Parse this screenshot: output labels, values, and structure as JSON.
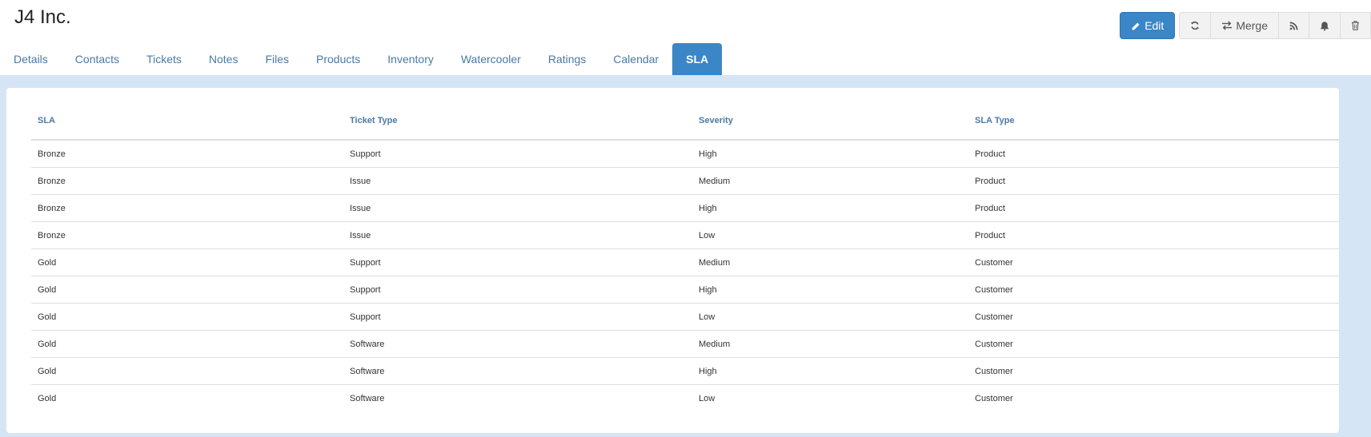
{
  "header": {
    "title": "J4 Inc."
  },
  "toolbar": {
    "edit_label": "Edit",
    "merge_label": "Merge",
    "icons": [
      "pencil-icon",
      "refresh-icon",
      "exchange-icon",
      "rss-icon",
      "bell-icon",
      "trash-icon"
    ]
  },
  "tabs": [
    {
      "label": "Details"
    },
    {
      "label": "Contacts"
    },
    {
      "label": "Tickets"
    },
    {
      "label": "Notes"
    },
    {
      "label": "Files"
    },
    {
      "label": "Products"
    },
    {
      "label": "Inventory"
    },
    {
      "label": "Watercooler"
    },
    {
      "label": "Ratings"
    },
    {
      "label": "Calendar"
    },
    {
      "label": "SLA",
      "active": true
    }
  ],
  "table": {
    "columns": [
      "SLA",
      "Ticket Type",
      "Severity",
      "SLA Type"
    ],
    "rows": [
      [
        "Bronze",
        "Support",
        "High",
        "Product"
      ],
      [
        "Bronze",
        "Issue",
        "Medium",
        "Product"
      ],
      [
        "Bronze",
        "Issue",
        "High",
        "Product"
      ],
      [
        "Bronze",
        "Issue",
        "Low",
        "Product"
      ],
      [
        "Gold",
        "Support",
        "Medium",
        "Customer"
      ],
      [
        "Gold",
        "Support",
        "High",
        "Customer"
      ],
      [
        "Gold",
        "Support",
        "Low",
        "Customer"
      ],
      [
        "Gold",
        "Software",
        "Medium",
        "Customer"
      ],
      [
        "Gold",
        "Software",
        "High",
        "Customer"
      ],
      [
        "Gold",
        "Software",
        "Low",
        "Customer"
      ]
    ]
  },
  "colors": {
    "accent": "#3b86c6",
    "band": "#d5e5f5",
    "link": "#4a7aa6"
  }
}
